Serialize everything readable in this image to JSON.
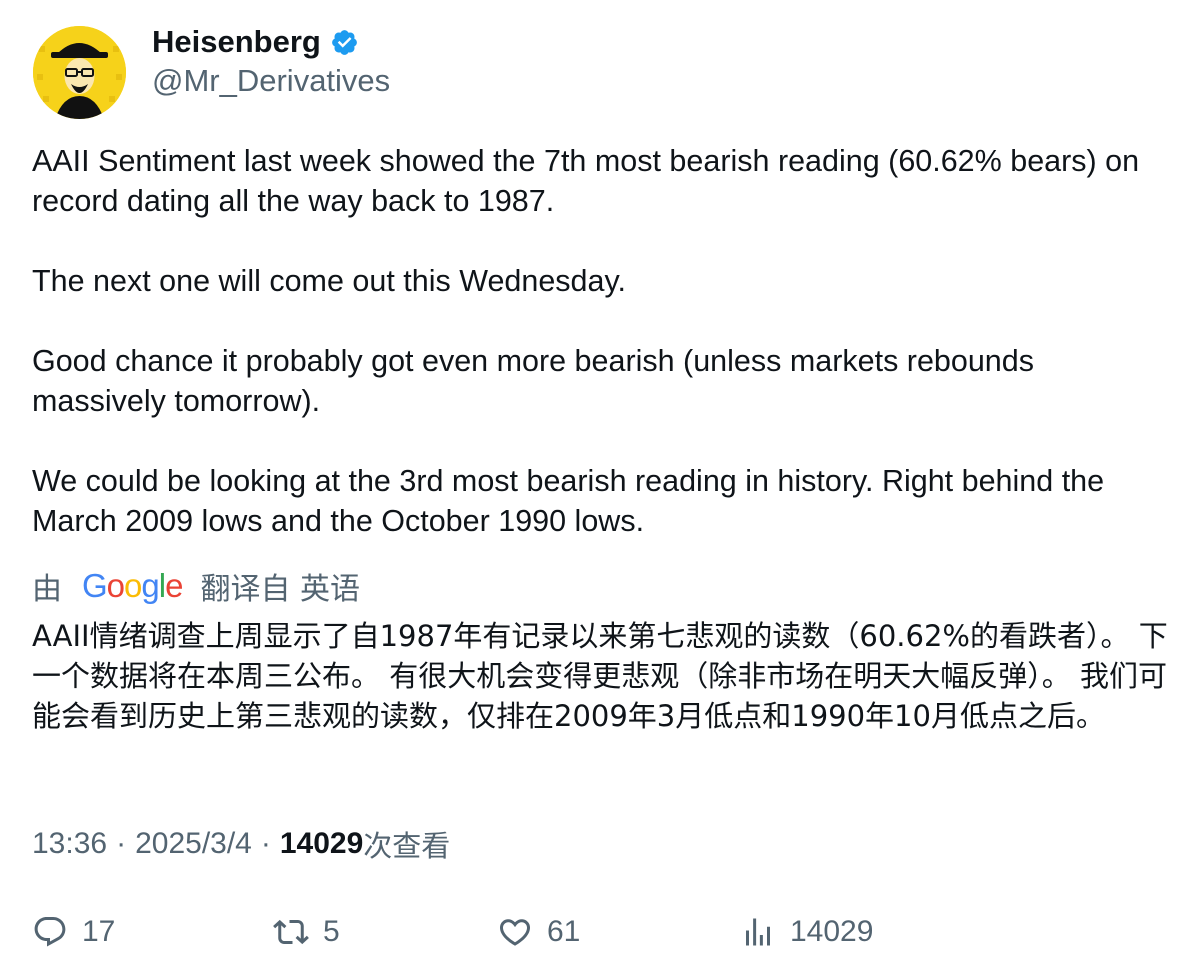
{
  "author": {
    "display_name": "Heisenberg",
    "handle": "@Mr_Derivatives",
    "verified": true
  },
  "tweet": {
    "paragraphs": [
      "AAII Sentiment last week showed the 7th most bearish reading (60.62% bears) on record dating all the way back to 1987.",
      "The next one will come out this Wednesday.",
      "Good chance it probably got even more bearish (unless markets rebounds massively tomorrow).",
      "We could be looking at the 3rd most bearish reading in history. Right behind the March 2009 lows and the October 1990 lows."
    ]
  },
  "translation": {
    "prefix": "由",
    "provider": "Google",
    "suffix": "翻译自 英语",
    "text": "AAII情绪调查上周显示了自1987年有记录以来第七悲观的读数（60.62%的看跌者）。 下一个数据将在本周三公布。 有很大机会变得更悲观（除非市场在明天大幅反弹）。 我们可能会看到历史上第三悲观的读数，仅排在2009年3月低点和1990年10月低点之后。"
  },
  "meta": {
    "time": "13:36",
    "separator": "·",
    "date": "2025/3/4",
    "views_count": "14029",
    "views_label": "次查看"
  },
  "actions": {
    "replies": "17",
    "retweets": "5",
    "likes": "61",
    "views": "14029"
  },
  "colors": {
    "text": "#0f1419",
    "secondary": "#536471",
    "verified": "#1d9bf0",
    "avatar_bg": "#f6d21a"
  },
  "icons": [
    "verified-badge-icon",
    "reply-icon",
    "retweet-icon",
    "like-icon",
    "views-icon"
  ]
}
